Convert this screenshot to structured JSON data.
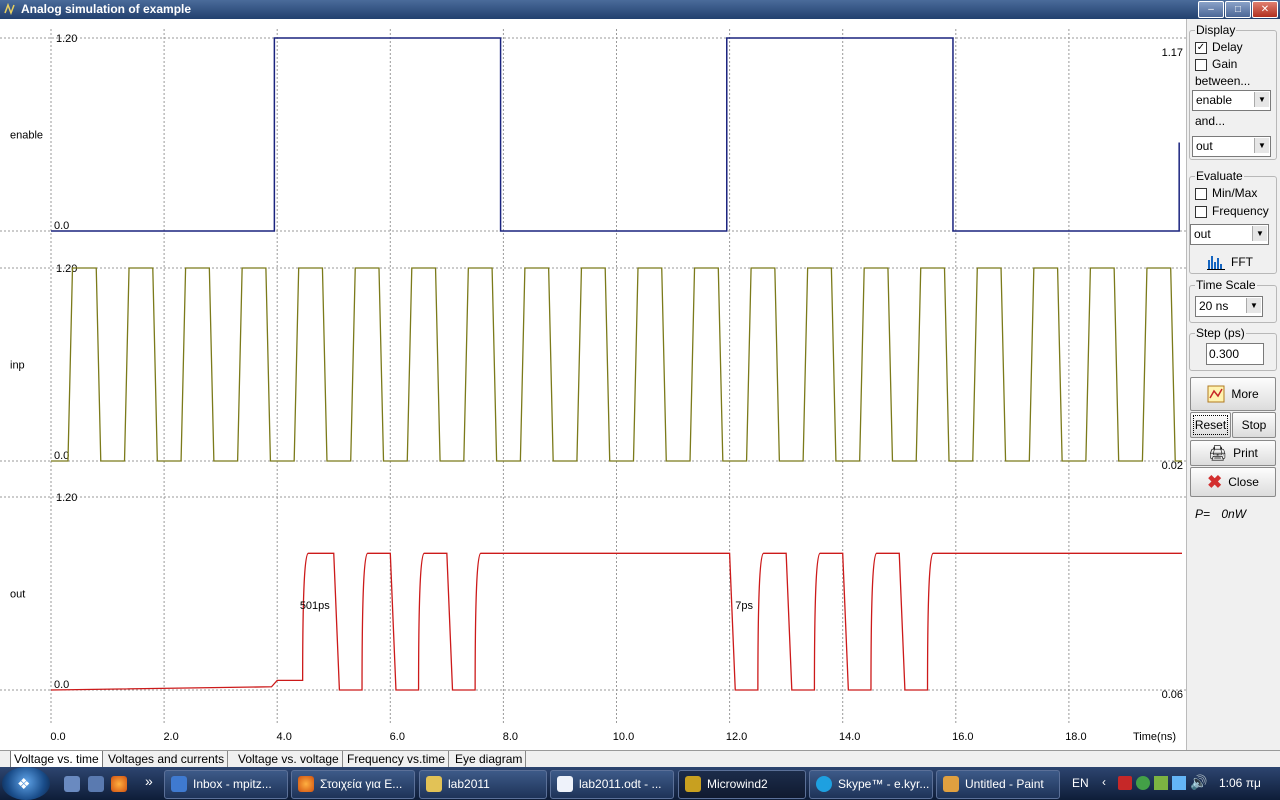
{
  "window": {
    "title": "Analog simulation of example"
  },
  "plot": {
    "signals": [
      {
        "name": "enable",
        "y_top_label": "1.20",
        "y_bottom_label": "0.0",
        "right_label": "1.17"
      },
      {
        "name": "inp",
        "y_top_label": "1.20",
        "y_bottom_label": "0.0",
        "right_label": "0.02"
      },
      {
        "name": "out",
        "y_top_label": "1.20",
        "y_bottom_label": "0.0",
        "right_label": "0.06"
      }
    ],
    "annotations": [
      "501ps",
      "7ps"
    ],
    "x_ticks": [
      "0.0",
      "2.0",
      "4.0",
      "6.0",
      "8.0",
      "10.0",
      "12.0",
      "14.0",
      "16.0",
      "18.0"
    ],
    "x_unit_label": "Time(ns)",
    "colors": {
      "enable": "#1a237e",
      "inp": "#7b7a1a",
      "out": "#cc1a1a",
      "grid": "#9a9a9a"
    }
  },
  "chart_data": [
    {
      "type": "line",
      "title": "",
      "ylabel": "enable",
      "xlabel": "Time(ns)",
      "ylim": [
        0,
        1.2
      ],
      "xlim": [
        0,
        20
      ],
      "series": [
        {
          "name": "enable",
          "x": [
            0,
            3.95,
            3.95,
            7.95,
            7.95,
            11.95,
            11.95,
            15.95,
            15.95,
            19.95,
            19.95
          ],
          "y": [
            0,
            0,
            1.2,
            1.2,
            0,
            0,
            1.2,
            1.2,
            0,
            0,
            0.55
          ]
        }
      ]
    },
    {
      "type": "line",
      "title": "",
      "ylabel": "inp",
      "xlabel": "Time(ns)",
      "ylim": [
        0,
        1.2
      ],
      "xlim": [
        0,
        20
      ],
      "series": [
        {
          "name": "inp",
          "period_ns": 1.0,
          "high": 1.2,
          "low": 0.0,
          "first_rise_ns": 0.3
        }
      ]
    },
    {
      "type": "line",
      "title": "",
      "ylabel": "out",
      "xlabel": "Time(ns)",
      "ylim": [
        0,
        1.2
      ],
      "xlim": [
        0,
        20
      ],
      "series": [
        {
          "name": "out",
          "x": [
            0,
            3.9,
            4.0,
            4.45,
            4.55,
            5.0,
            5.1,
            5.5,
            5.6,
            6.0,
            6.1,
            6.5,
            6.6,
            7.0,
            7.1,
            7.5,
            7.6,
            12.0,
            12.1,
            12.5,
            12.6,
            13.0,
            13.1,
            13.5,
            13.6,
            14.0,
            14.1,
            14.5,
            14.6,
            15.0,
            15.1,
            15.5,
            15.6,
            20.0
          ],
          "y": [
            0,
            0.02,
            0.06,
            0.06,
            0.85,
            0.85,
            0,
            0,
            0.85,
            0.85,
            0,
            0,
            0.85,
            0.85,
            0,
            0,
            0.85,
            0.85,
            0,
            0,
            0.85,
            0.85,
            0,
            0,
            0.85,
            0.85,
            0,
            0,
            0.85,
            0.85,
            0,
            0,
            0.85,
            0.85
          ]
        }
      ]
    }
  ],
  "panel": {
    "display": {
      "title": "Display",
      "delay_label": "Delay",
      "delay_checked": true,
      "gain_label": "Gain",
      "between_label": "between...",
      "between_value": "enable",
      "and_label": "and...",
      "and_value": "out"
    },
    "evaluate": {
      "title": "Evaluate",
      "minmax_label": "Min/Max",
      "frequency_label": "Frequency",
      "value": "out",
      "fft_label": "FFT"
    },
    "time_scale": {
      "title": "Time Scale",
      "value": "20 ns"
    },
    "step": {
      "title": "Step (ps)",
      "value": "0.300"
    },
    "buttons": {
      "more": "More",
      "reset": "Reset",
      "stop": "Stop",
      "print": "Print",
      "close": "Close"
    },
    "power": {
      "label": "P=",
      "value": "0nW"
    }
  },
  "tabs": [
    "Voltage vs. time",
    "Voltages and currents",
    "Voltage vs. voltage",
    "Frequency vs.time",
    "Eye diagram"
  ],
  "taskbar": {
    "buttons": [
      "Inbox - mpitz...",
      "Στοιχεία για Ε...",
      "lab2011",
      "lab2011.odt - ...",
      "Microwind2",
      "Skype™ - e.kyr...",
      "Untitled - Paint"
    ],
    "lang": "EN",
    "clock": "1:06 πμ",
    "chevron": "»"
  }
}
